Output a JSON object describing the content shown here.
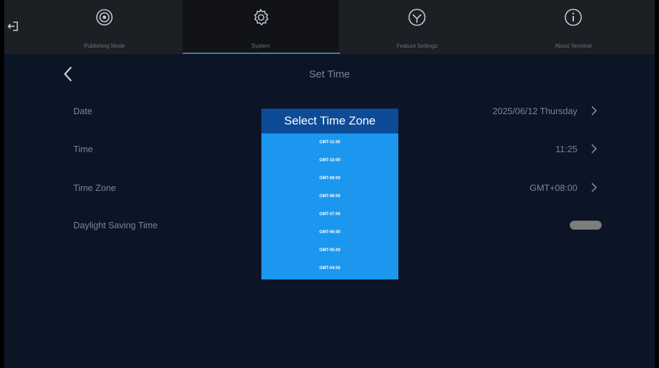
{
  "nav": {
    "tabs": [
      {
        "label": "Publishing Mode",
        "icon": "target-icon",
        "active": false
      },
      {
        "label": "System",
        "icon": "gear-icon",
        "active": true
      },
      {
        "label": "Feature Settings",
        "icon": "cube-icon",
        "active": false
      },
      {
        "label": "About Terminal",
        "icon": "info-icon",
        "active": false
      }
    ]
  },
  "page": {
    "title": "Set Time"
  },
  "settings": {
    "date": {
      "label": "Date",
      "value": "2025/06/12  Thursday"
    },
    "time": {
      "label": "Time",
      "value": "11:25"
    },
    "time_zone": {
      "label": "Time Zone",
      "value": "GMT+08:00"
    },
    "dst": {
      "label": "Daylight Saving Time",
      "enabled": false
    }
  },
  "modal": {
    "title": "Select Time Zone",
    "options": [
      "GMT-11:00",
      "GMT-10:00",
      "GMT-09:00",
      "GMT-08:00",
      "GMT-07:00",
      "GMT-06:00",
      "GMT-05:00",
      "GMT-04:00"
    ]
  },
  "colors": {
    "background": "#0b1526",
    "topbar": "#1c1f24",
    "modal_header": "#0d4b97",
    "modal_body": "#1c97ef",
    "muted_text": "#7c8591"
  }
}
